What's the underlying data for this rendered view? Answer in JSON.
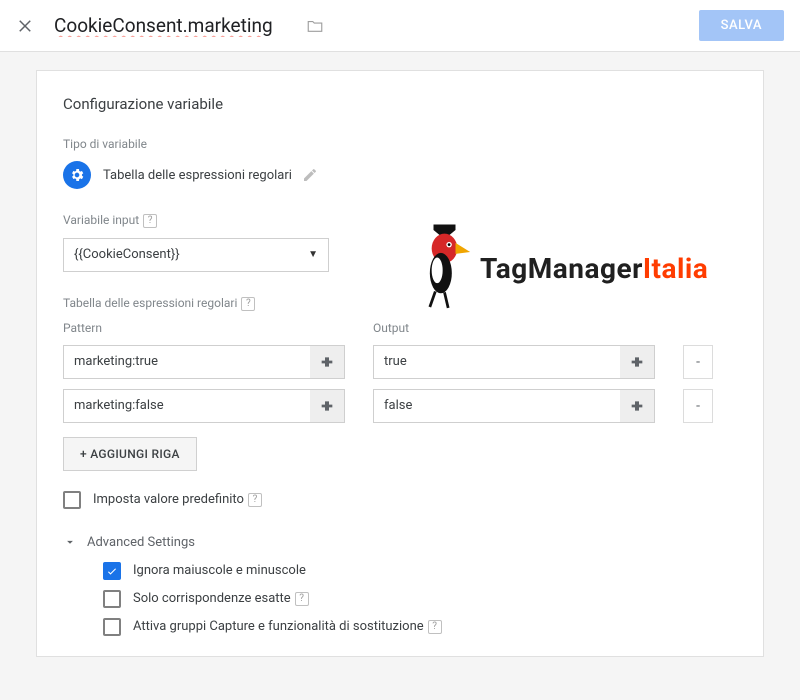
{
  "header": {
    "title": "CookieConsent.marketing",
    "save_label": "SALVA"
  },
  "panel": {
    "title": "Configurazione variabile",
    "vartype_section": "Tipo di variabile",
    "vartype_value": "Tabella delle espressioni regolari",
    "input_var_label": "Variabile input",
    "input_var_value": "{{CookieConsent}}",
    "table_label": "Tabella delle espressioni regolari",
    "col_pattern": "Pattern",
    "col_output": "Output",
    "rows": [
      {
        "pattern": "marketing:true",
        "output": "true"
      },
      {
        "pattern": "marketing:false",
        "output": "false"
      }
    ],
    "add_row": "+ AGGIUNGI RIGA",
    "default_value_label": "Imposta valore predefinito",
    "advanced": {
      "title": "Advanced Settings",
      "ignore_case": "Ignora maiuscole e minuscole",
      "exact_match": "Solo corrispondenze esatte",
      "capture_groups": "Attiva gruppi Capture e funzionalità di sostituzione"
    }
  },
  "logo": {
    "part1": "TagManager",
    "part2": "Italia"
  }
}
